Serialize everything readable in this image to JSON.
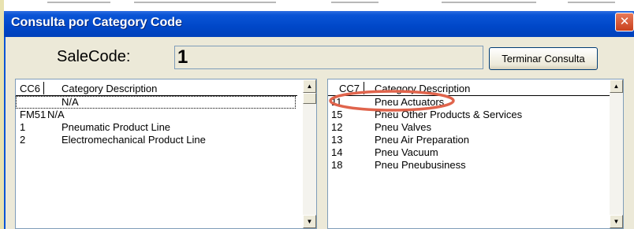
{
  "window": {
    "title": "Consulta  por  Category Code",
    "close_glyph": "✕"
  },
  "header": {
    "salecode_label": "SaleCode:",
    "salecode_value": "1",
    "terminar_label": "Terminar Consulta"
  },
  "left_list": {
    "header_code": "CC6",
    "header_desc": "Category Description",
    "rows": [
      {
        "code": "",
        "desc": "N/A"
      },
      {
        "code": "FM51",
        "desc": "N/A"
      },
      {
        "code": "1",
        "desc": "Pneumatic Product Line"
      },
      {
        "code": "2",
        "desc": "Electromechanical Product Line"
      }
    ]
  },
  "right_list": {
    "header_code": "CC7",
    "header_desc": "Category Description",
    "rows": [
      {
        "code": "11",
        "desc": "Pneu Actuators"
      },
      {
        "code": "15",
        "desc": "Pneu Other Products & Services"
      },
      {
        "code": "12",
        "desc": "Pneu Valves"
      },
      {
        "code": "13",
        "desc": "Pneu Air Preparation"
      },
      {
        "code": "14",
        "desc": "Pneu Vacuum"
      },
      {
        "code": "18",
        "desc": "Pneu Pneubusiness"
      }
    ]
  },
  "icons": {
    "scroll_up": "▲",
    "scroll_down": "▼"
  },
  "colors": {
    "titlebar": "#0047c8",
    "window_bg": "#ece9d8",
    "highlight_ellipse": "#e0644c"
  }
}
